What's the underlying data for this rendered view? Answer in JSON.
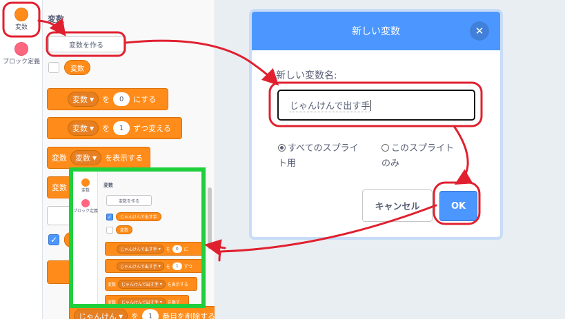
{
  "categories": [
    {
      "label": "変数",
      "color": "#ff8c1a"
    },
    {
      "label": "ブロック定義",
      "color": "#ff6680"
    }
  ],
  "palette": {
    "title": "変数",
    "make_variable_label": "変数を作る",
    "reporter_label": "変数",
    "blocks": {
      "set": {
        "variable": "変数",
        "particle": "を",
        "value": "0",
        "suffix": "にする"
      },
      "change": {
        "variable": "変数",
        "particle": "を",
        "value": "1",
        "suffix": "ずつ変える"
      },
      "show": {
        "prefix": "変数",
        "variable": "変数",
        "suffix": "を表示する"
      },
      "bottom": {
        "prefix": "変数",
        "variable": "じゃんけん",
        "value": "1",
        "suffix": "番目を削除する",
        "partial": "を"
      }
    }
  },
  "dialog": {
    "title": "新しい変数",
    "field_label": "新しい変数名:",
    "input_value": "じゃんけんで出す手",
    "option_all_line1": "すべてのスプライ",
    "option_all_line2": "ト用",
    "option_this_line1": "このスプライト",
    "option_this_line2": "のみ",
    "cancel_label": "キャンセル",
    "ok_label": "OK"
  },
  "inset": {
    "categories": [
      {
        "label": "変数",
        "color": "#ff8c1a"
      },
      {
        "label": "ブロック定義",
        "color": "#ff6680"
      }
    ],
    "title": "変数",
    "make_variable_label": "変数を作る",
    "new_var_reporter": "じゃんけんで出す手",
    "var_reporter": "変数",
    "set": {
      "variable": "じゃんけんで出す手",
      "particle": "を",
      "value": "0",
      "suffix": "に"
    },
    "change": {
      "variable": "じゃんけんで出す手",
      "particle": "を",
      "value": "1",
      "suffix": "ずつ"
    },
    "show": {
      "prefix": "変数",
      "variable": "じゃんけんで出す手",
      "suffix": "を表示する"
    },
    "hide": {
      "prefix": "変数",
      "variable": "じゃんけんで出す手",
      "suffix": "を隠す"
    }
  },
  "colors": {
    "variables": "#ff8c1a",
    "my_blocks": "#ff6680",
    "dialog_header": "#4c97ff",
    "annotation_red": "#e0202f",
    "annotation_green": "#1fd03c"
  }
}
